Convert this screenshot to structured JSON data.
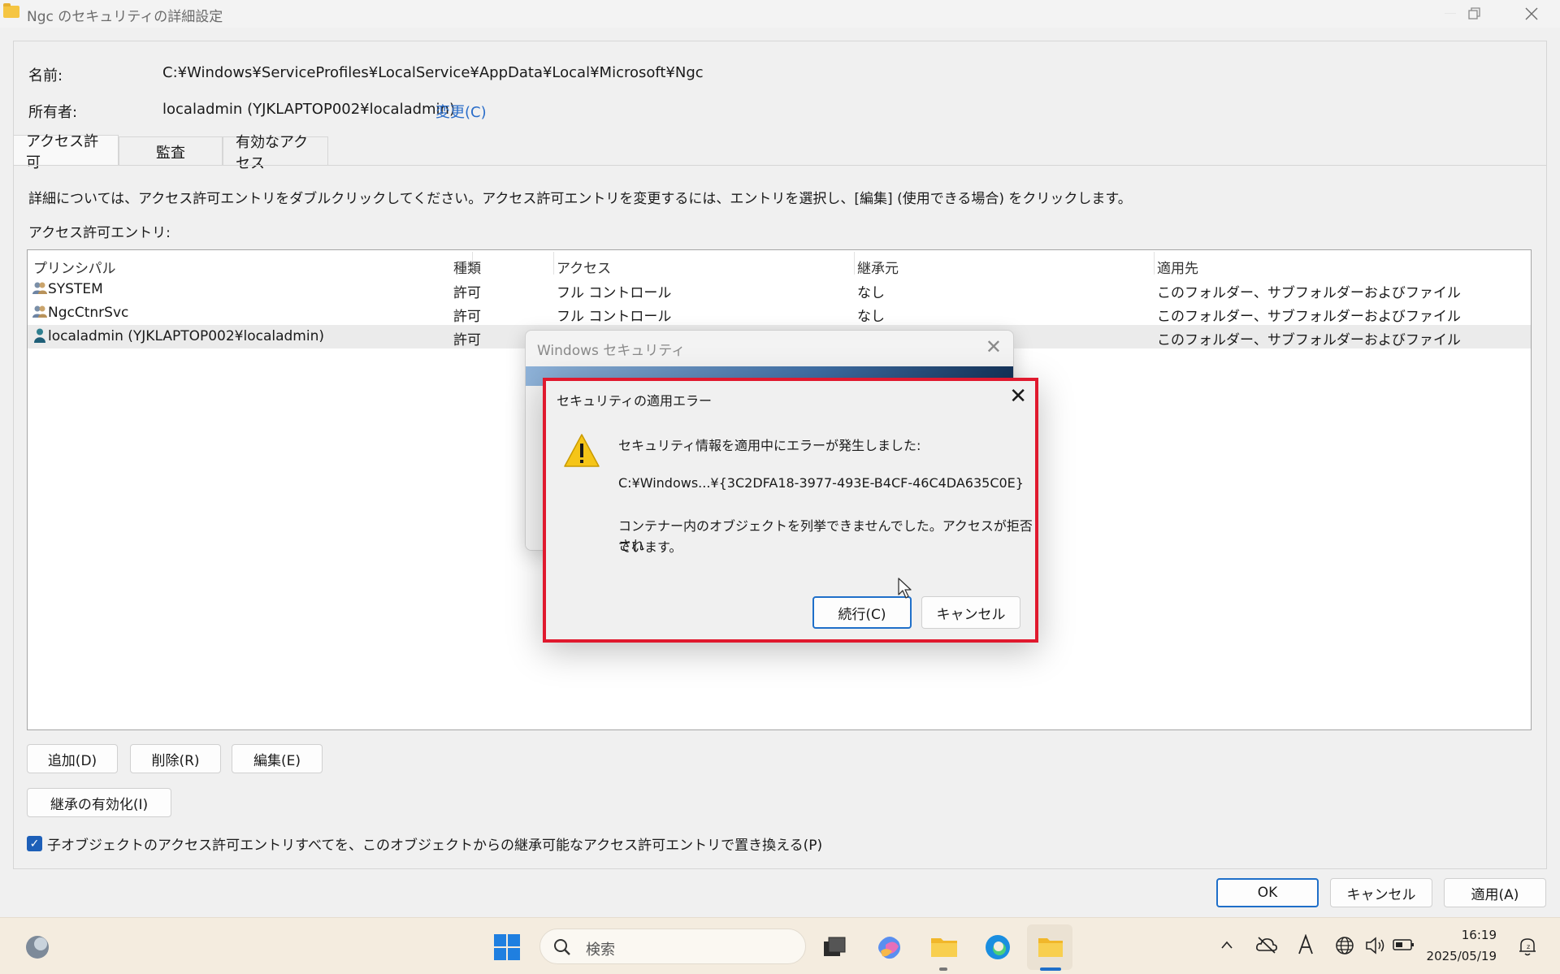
{
  "window": {
    "title": "Ngc のセキュリティの詳細設定"
  },
  "header": {
    "name_label": "名前:",
    "name_value": "C:¥Windows¥ServiceProfiles¥LocalService¥AppData¥Local¥Microsoft¥Ngc",
    "owner_label": "所有者:",
    "owner_value": "localadmin (YJKLAPTOP002¥localadmin)",
    "owner_change": "変更(C)"
  },
  "tabs": [
    {
      "label": "アクセス許可"
    },
    {
      "label": "監査"
    },
    {
      "label": "有効なアクセス"
    }
  ],
  "info_text": "詳細については、アクセス許可エントリをダブルクリックしてください。アクセス許可エントリを変更するには、エントリを選択し、[編集] (使用できる場合) をクリックします。",
  "entries_label": "アクセス許可エントリ:",
  "table": {
    "columns": [
      "プリンシパル",
      "種類",
      "アクセス",
      "継承元",
      "適用先"
    ],
    "rows": [
      {
        "principal": "SYSTEM",
        "type": "許可",
        "access": "フル コントロール",
        "inherited": "なし",
        "applies": "このフォルダー、サブフォルダーおよびファイル"
      },
      {
        "principal": "NgcCtnrSvc",
        "type": "許可",
        "access": "フル コントロール",
        "inherited": "なし",
        "applies": "このフォルダー、サブフォルダーおよびファイル"
      },
      {
        "principal": "localadmin (YJKLAPTOP002¥localadmin)",
        "type": "許可",
        "access": "",
        "inherited": "",
        "applies": "このフォルダー、サブフォルダーおよびファイル"
      }
    ]
  },
  "buttons": {
    "add": "追加(D)",
    "remove": "削除(R)",
    "edit": "編集(E)",
    "enable_inheritance": "継承の有効化(I)",
    "ok": "OK",
    "cancel": "キャンセル",
    "apply": "適用(A)"
  },
  "replace_checkbox": {
    "label": "子オブジェクトのアクセス許可エントリすべてを、このオブジェクトからの継承可能なアクセス許可エントリで置き換える(P)",
    "checked": true
  },
  "back_dialog": {
    "title": "Windows セキュリティ"
  },
  "error_dialog": {
    "title": "セキュリティの適用エラー",
    "line1": "セキュリティ情報を適用中にエラーが発生しました:",
    "path": "C:¥Windows...¥{3C2DFA18-3977-493E-B4CF-46C4DA635C0E}",
    "line3a": "コンテナー内のオブジェクトを列挙できませんでした。アクセスが拒否され",
    "line3b": "ています。",
    "continue_btn": "続行(C)",
    "cancel_btn": "キャンセル",
    "highlight_color": "#e0192e"
  },
  "taskbar": {
    "search_placeholder": "検索",
    "time": "16:19",
    "date": "2025/05/19"
  },
  "colors": {
    "accent": "#1f6fc9",
    "link": "#2a6dc9"
  }
}
